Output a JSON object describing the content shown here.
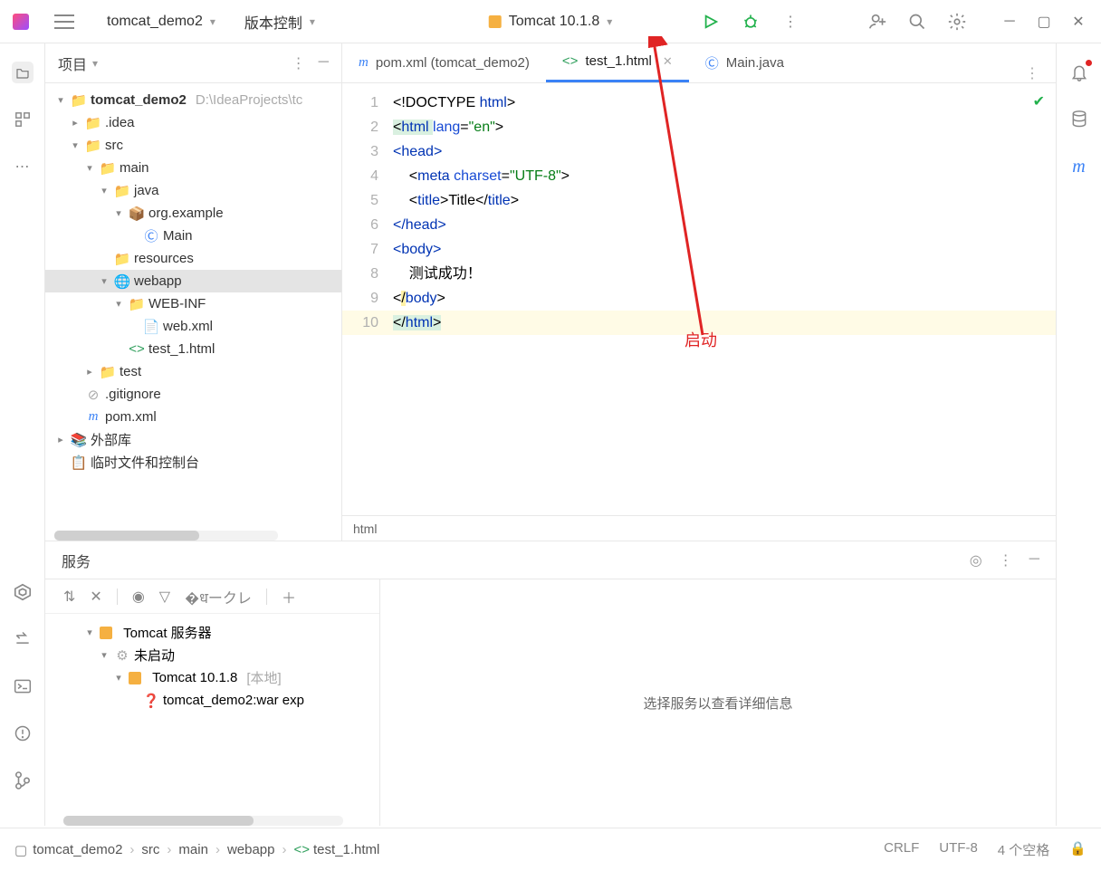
{
  "titlebar": {
    "project_name": "tomcat_demo2",
    "version_control": "版本控制",
    "run_config": "Tomcat 10.1.8"
  },
  "project_panel": {
    "title": "项目",
    "root": "tomcat_demo2",
    "root_path": "D:\\IdeaProjects\\tc",
    "nodes": {
      "idea": ".idea",
      "src": "src",
      "main": "main",
      "java": "java",
      "pkg": "org.example",
      "main_cls": "Main",
      "resources": "resources",
      "webapp": "webapp",
      "webinf": "WEB-INF",
      "webxml": "web.xml",
      "test1": "test_1.html",
      "test": "test",
      "gitignore": ".gitignore",
      "pom": "pom.xml",
      "ext_libs": "外部库",
      "scratch": "临时文件和控制台"
    }
  },
  "tabs": {
    "t1": "pom.xml (tomcat_demo2)",
    "t2": "test_1.html",
    "t3": "Main.java"
  },
  "code": {
    "l1a": "<!DOCTYPE ",
    "l1b": "html",
    "l1c": ">",
    "l2a": "<",
    "l2b": "html ",
    "l2c": "lang",
    "l2d": "=",
    "l2e": "\"en\"",
    "l2f": ">",
    "l3": "<head>",
    "l4a": "    <",
    "l4b": "meta ",
    "l4c": "charset",
    "l4d": "=",
    "l4e": "\"UTF-8\"",
    "l4f": ">",
    "l5a": "    <",
    "l5b": "title",
    "l5c": ">Title</",
    "l5d": "title",
    "l5e": ">",
    "l6": "</head>",
    "l7": "<body>",
    "l8": "    测试成功！",
    "l9": "</body>",
    "l10a": "</",
    "l10b": "html",
    "l10c": ">",
    "gutter": [
      "1",
      "2",
      "3",
      "4",
      "5",
      "6",
      "7",
      "8",
      "9",
      "10"
    ]
  },
  "breadcrumb_mini": "html",
  "services": {
    "title": "服务",
    "root": "Tomcat 服务器",
    "not_started": "未启动",
    "server": "Tomcat 10.1.8",
    "server_kind": "[本地]",
    "artifact": "tomcat_demo2:war exp",
    "empty_msg": "选择服务以查看详细信息"
  },
  "statusbar": {
    "c1": "tomcat_demo2",
    "c2": "src",
    "c3": "main",
    "c4": "webapp",
    "c5": "test_1.html",
    "crlf": "CRLF",
    "enc": "UTF-8",
    "indent": "4 个空格"
  },
  "annotation": {
    "label": "启动"
  }
}
